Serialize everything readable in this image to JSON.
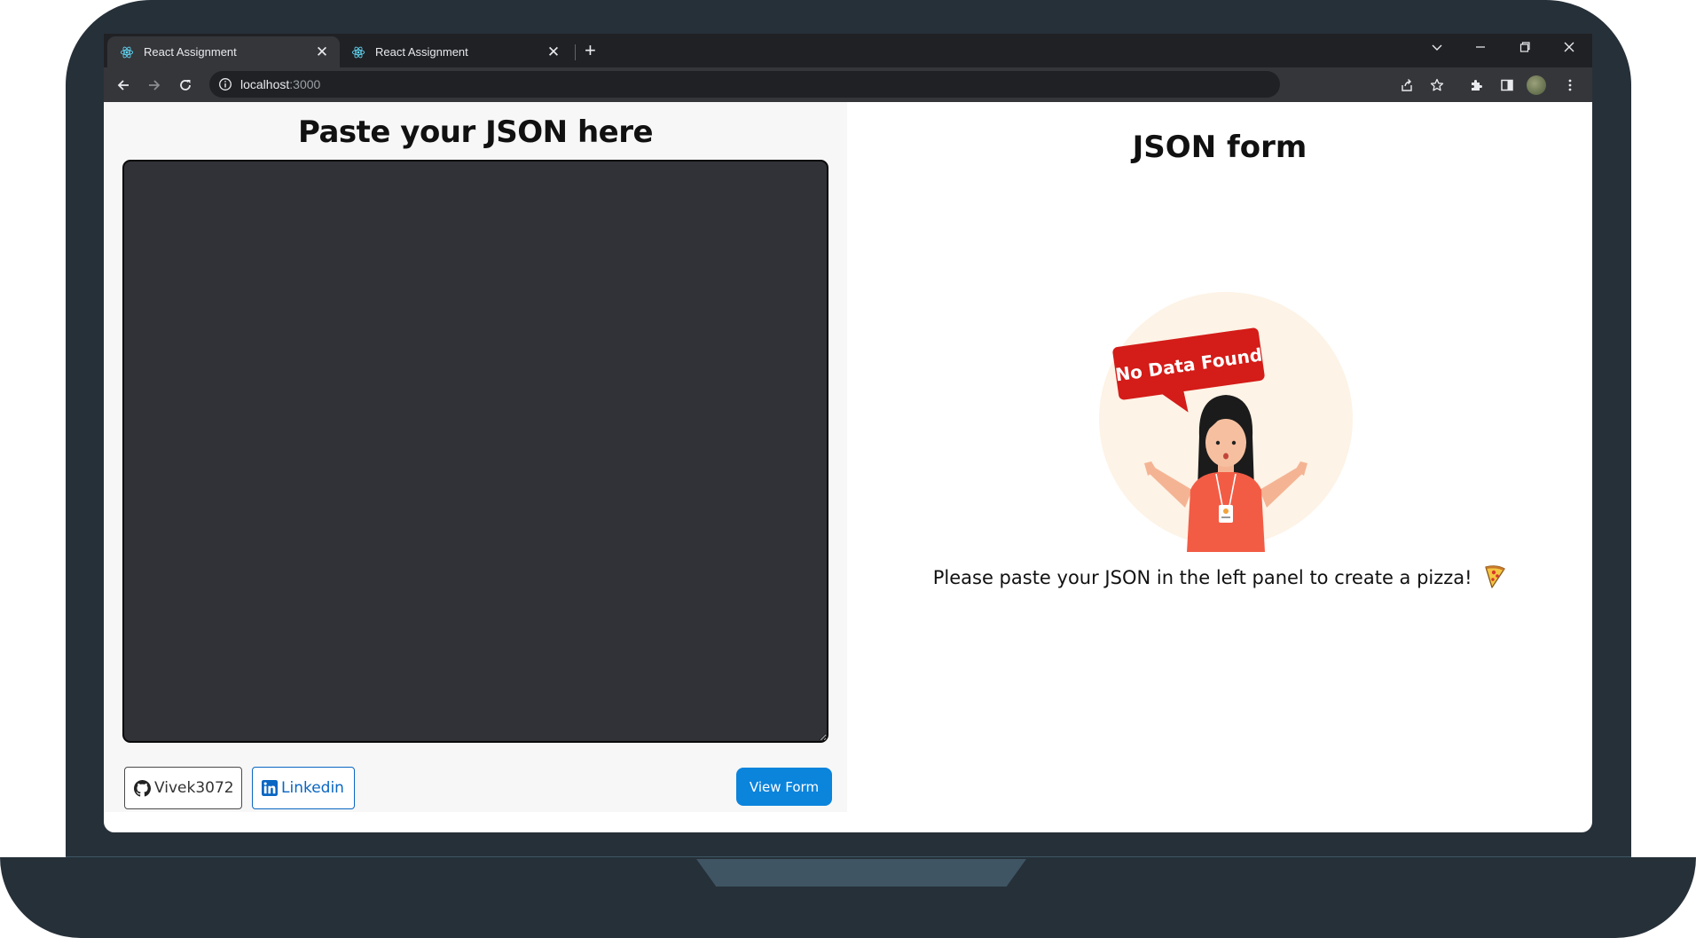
{
  "browser": {
    "tabs": [
      {
        "title": "React Assignment",
        "active": true
      },
      {
        "title": "React Assignment",
        "active": false
      }
    ],
    "url_host": "localhost",
    "url_rest": ":3000"
  },
  "left_panel": {
    "title": "Paste your JSON here",
    "json_input_value": "",
    "github_label": "Vivek3072",
    "linkedin_label": "Linkedin",
    "view_form_label": "View Form"
  },
  "right_panel": {
    "title": "JSON form",
    "illustration_text": "No Data Found",
    "empty_message": "Please paste your JSON in the left panel to create a pizza!",
    "empty_message_icon": "pizza-icon"
  },
  "colors": {
    "primary_button": "#0b84dc",
    "linkedin_blue": "#0a66c2",
    "editor_background": "#313237",
    "badge_red": "#d41c18"
  }
}
